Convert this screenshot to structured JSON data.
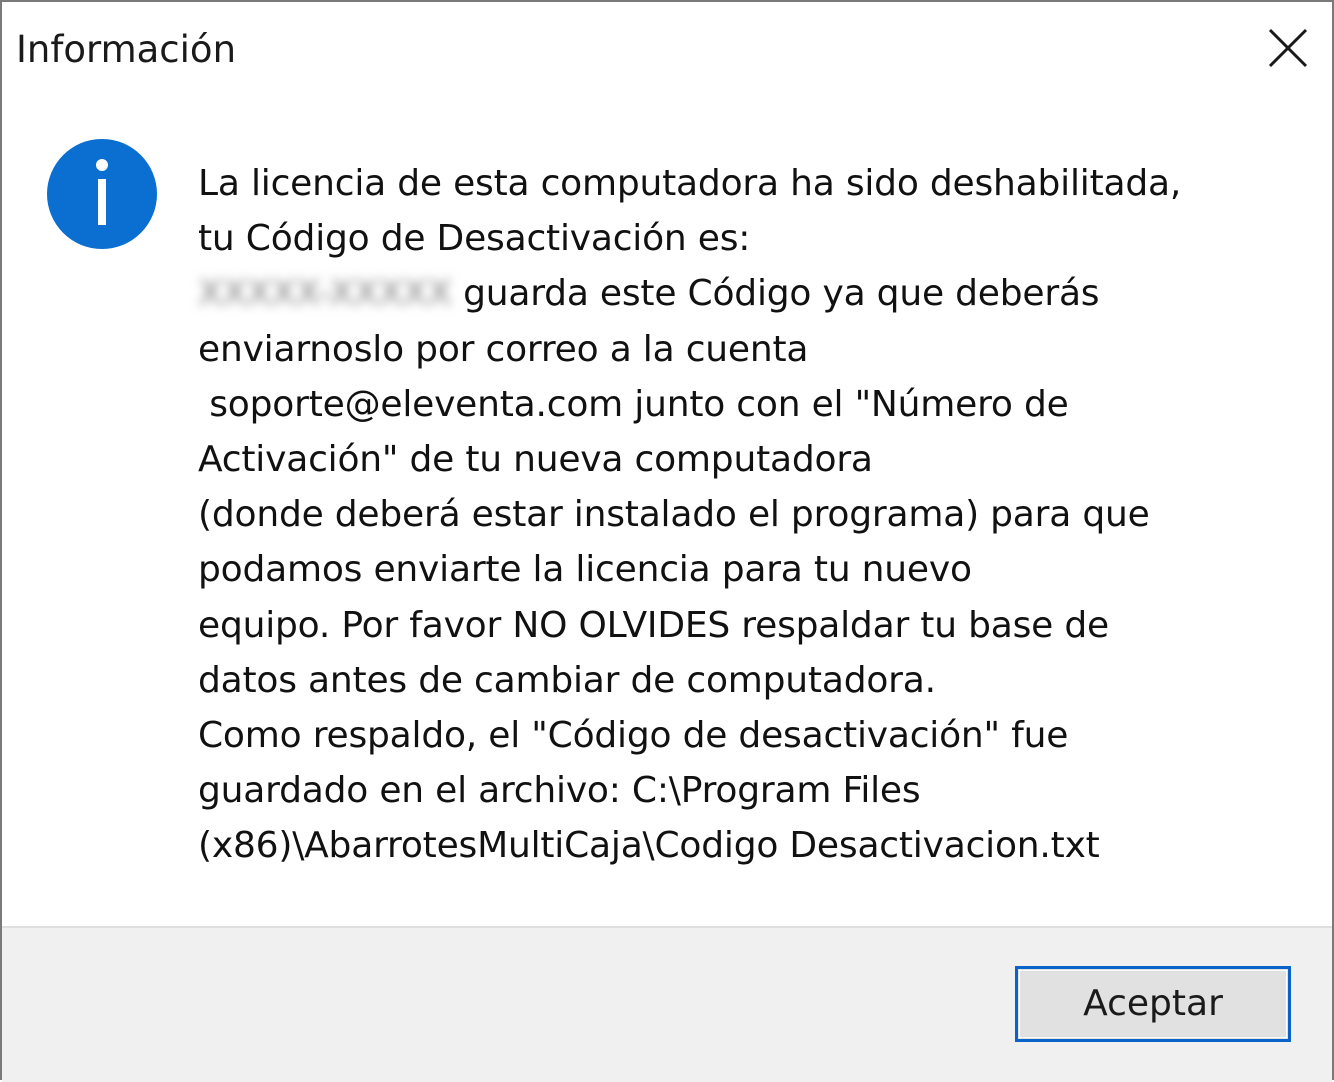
{
  "window": {
    "title": "Información",
    "close_icon": "close-icon"
  },
  "icon": {
    "name": "info-icon",
    "color": "#0a6fd1"
  },
  "message": {
    "line1": "La licencia de esta computadora ha sido deshabilitada,",
    "line2": "tu Código de Desactivación es:",
    "code_redacted": "XXXXX-XXXXX",
    "line3_rest": " guarda este Código ya que deberás",
    "line4": "enviarnoslo por correo a la cuenta",
    "line5": " soporte@eleventa.com junto con el \"Número de",
    "line6": "Activación\" de tu nueva computadora",
    "line7": "(donde deberá estar instalado el programa) para que",
    "line8": "podamos enviarte la licencia para tu nuevo",
    "line9": "equipo. Por favor NO OLVIDES respaldar tu base de",
    "line10": "datos antes de cambiar de computadora.",
    "line11": "Como respaldo, el \"Código de desactivación\" fue",
    "line12": "guardado en el archivo: C:\\Program Files",
    "line13": "(x86)\\AbarrotesMultiCaja\\Codigo Desactivacion.txt"
  },
  "footer": {
    "accept_label": "Aceptar"
  },
  "colors": {
    "accent": "#0a64c8",
    "footer_bg": "#f0f0f0",
    "button_bg": "#e1e1e1"
  }
}
